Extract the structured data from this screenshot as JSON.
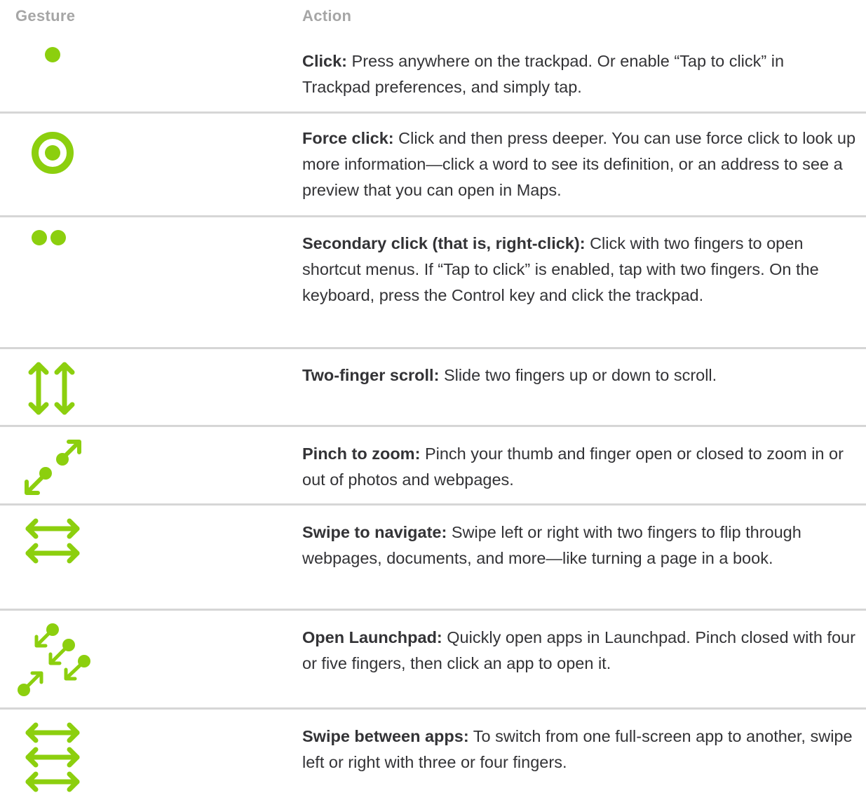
{
  "colors": {
    "accent": "#8ccf0e",
    "header_text": "#a6a6a6",
    "body_text": "#333336",
    "divider": "#d6d6d6"
  },
  "table": {
    "headers": {
      "gesture": "Gesture",
      "action": "Action"
    },
    "rows": [
      {
        "icon": "single-dot-icon",
        "title": "Click:",
        "description": "Press anywhere on the trackpad. Or enable “Tap to click” in Trackpad preferences, and simply tap."
      },
      {
        "icon": "force-click-ring-icon",
        "title": "Force click:",
        "description": "Click and then press deeper. You can use force click to look up more information—click a word to see its definition, or an address to see a preview that you can open in Maps."
      },
      {
        "icon": "two-dots-icon",
        "title": "Secondary click (that is, right-click):",
        "description": "Click with two fingers to open shortcut menus. If “Tap to click” is enabled, tap with two fingers. On the keyboard, press the Control key and click the trackpad."
      },
      {
        "icon": "vertical-double-arrows-icon",
        "title": "Two-finger scroll:",
        "description": "Slide two fingers up or down to scroll."
      },
      {
        "icon": "pinch-diagonal-arrows-icon",
        "title": "Pinch to zoom:",
        "description": "Pinch your thumb and finger open or closed to zoom in or out of photos and webpages."
      },
      {
        "icon": "two-horizontal-arrows-icon",
        "title": "Swipe to navigate:",
        "description": "Swipe left or right with two fingers to flip through webpages, documents, and more—like turning a page in a book."
      },
      {
        "icon": "launchpad-pinch-icon",
        "title": "Open Launchpad:",
        "description": "Quickly open apps in Launchpad. Pinch closed with four or five fingers, then click an app to open it."
      },
      {
        "icon": "three-horizontal-arrows-icon",
        "title": "Swipe between apps:",
        "description": "To switch from one full-screen app to another, swipe left or right with three or four fingers."
      }
    ]
  }
}
